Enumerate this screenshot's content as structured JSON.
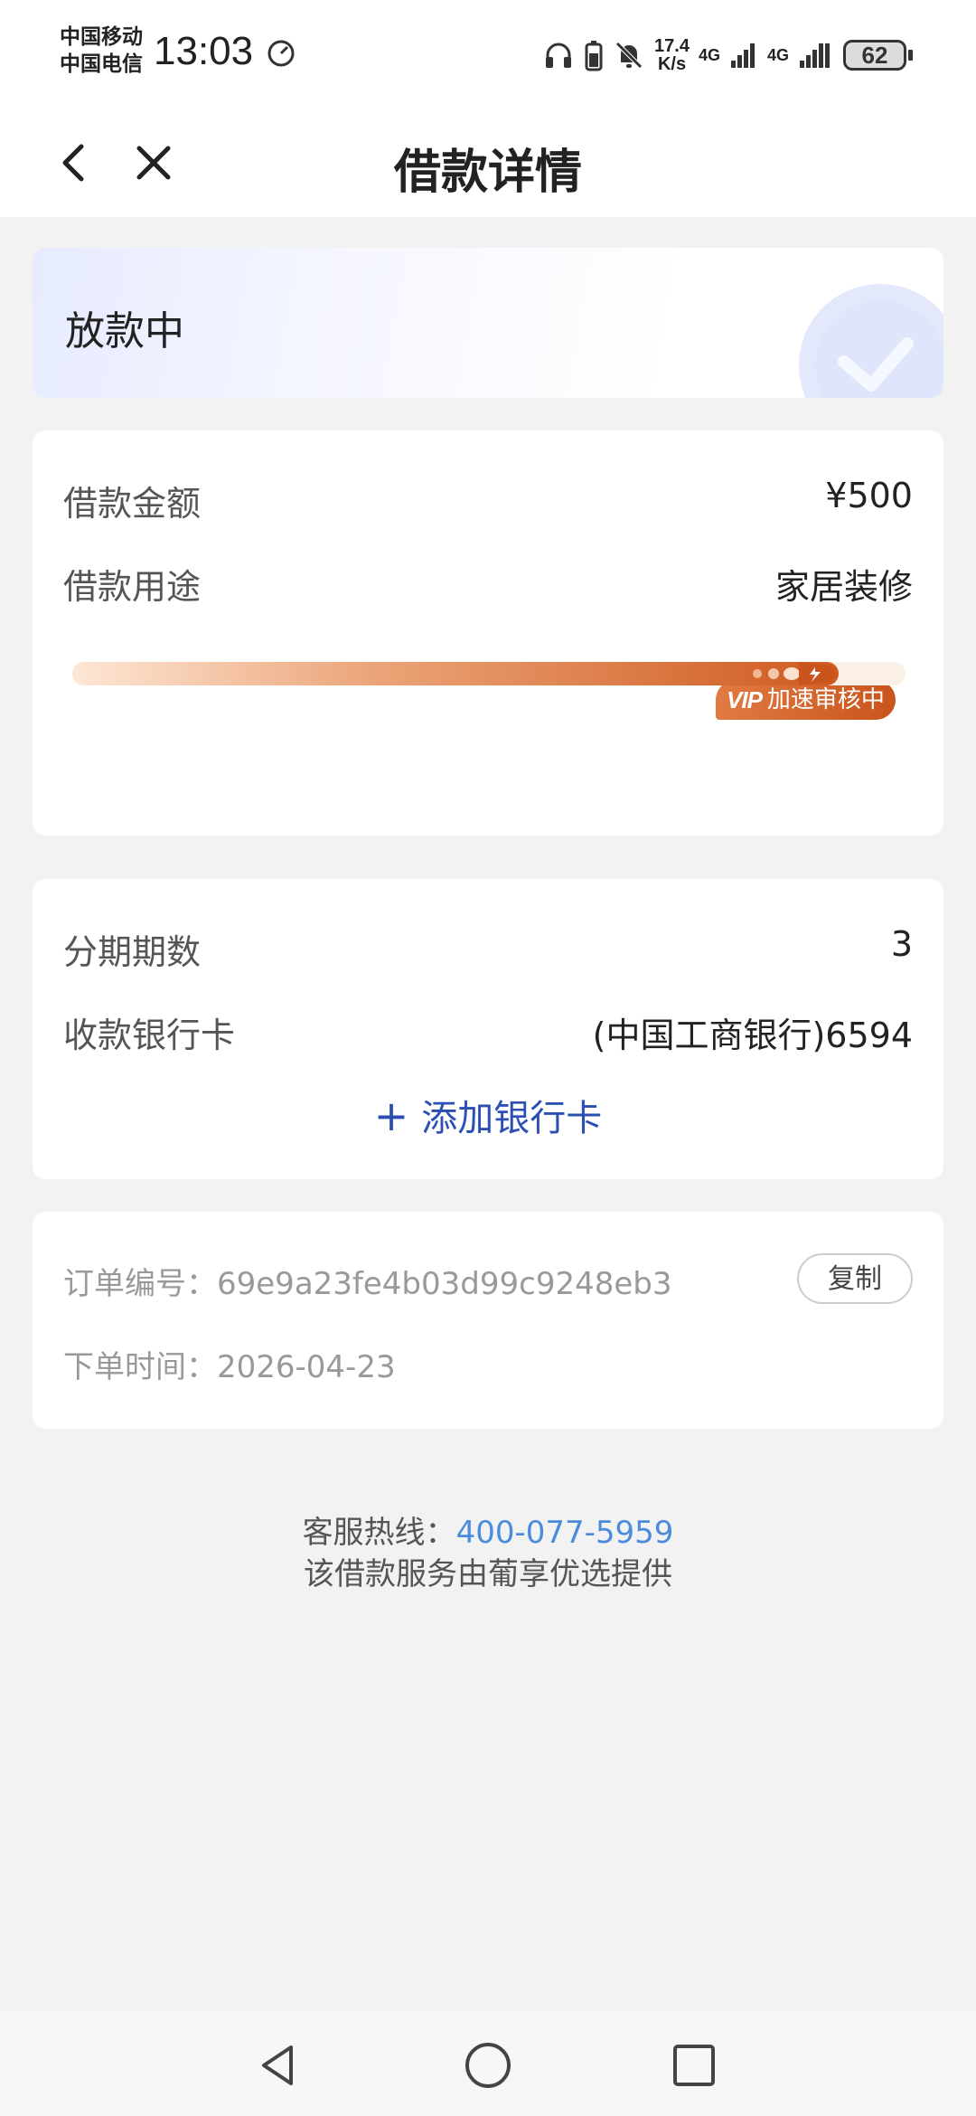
{
  "status_bar": {
    "carrier1": "中国移动",
    "carrier2": "中国电信",
    "time": "13:03",
    "net_speed_value": "17.4",
    "net_speed_unit": "K/s",
    "sig1": "4G",
    "sig2": "4G",
    "battery": "62"
  },
  "nav": {
    "title": "借款详情"
  },
  "status_card": {
    "status": "放款中"
  },
  "loan": {
    "amount_label": "借款金额",
    "amount_value": "¥500",
    "purpose_label": "借款用途",
    "purpose_value": "家居装修",
    "vip_text": "VIP",
    "badge_text": "加速审核中",
    "progress": 0.92
  },
  "installment": {
    "periods_label": "分期期数",
    "periods_value": "3",
    "bank_label": "收款银行卡",
    "bank_value": "(中国工商银行)6594",
    "add_card_label": "添加银行卡"
  },
  "order": {
    "number_label": "订单编号：",
    "number_value": "69e9a23fe4b03d99c9248eb3",
    "copy_label": "复制",
    "time_label": "下单时间：",
    "time_value": "2026-04-23"
  },
  "footer": {
    "hotline_label": "客服热线：",
    "hotline_number": "400-077-5959",
    "provider": "该借款服务由葡享优选提供"
  },
  "colors": {
    "accent_blue": "#2c4fb3",
    "link_blue": "#4a8bdc",
    "vip_orange": "#c9541c"
  },
  "icons": [
    "back-icon",
    "close-icon",
    "check-icon",
    "rocket-icon",
    "plus-icon",
    "headphones-icon",
    "bell-off-icon",
    "triangle-back-icon",
    "circle-home-icon",
    "square-recents-icon"
  ]
}
